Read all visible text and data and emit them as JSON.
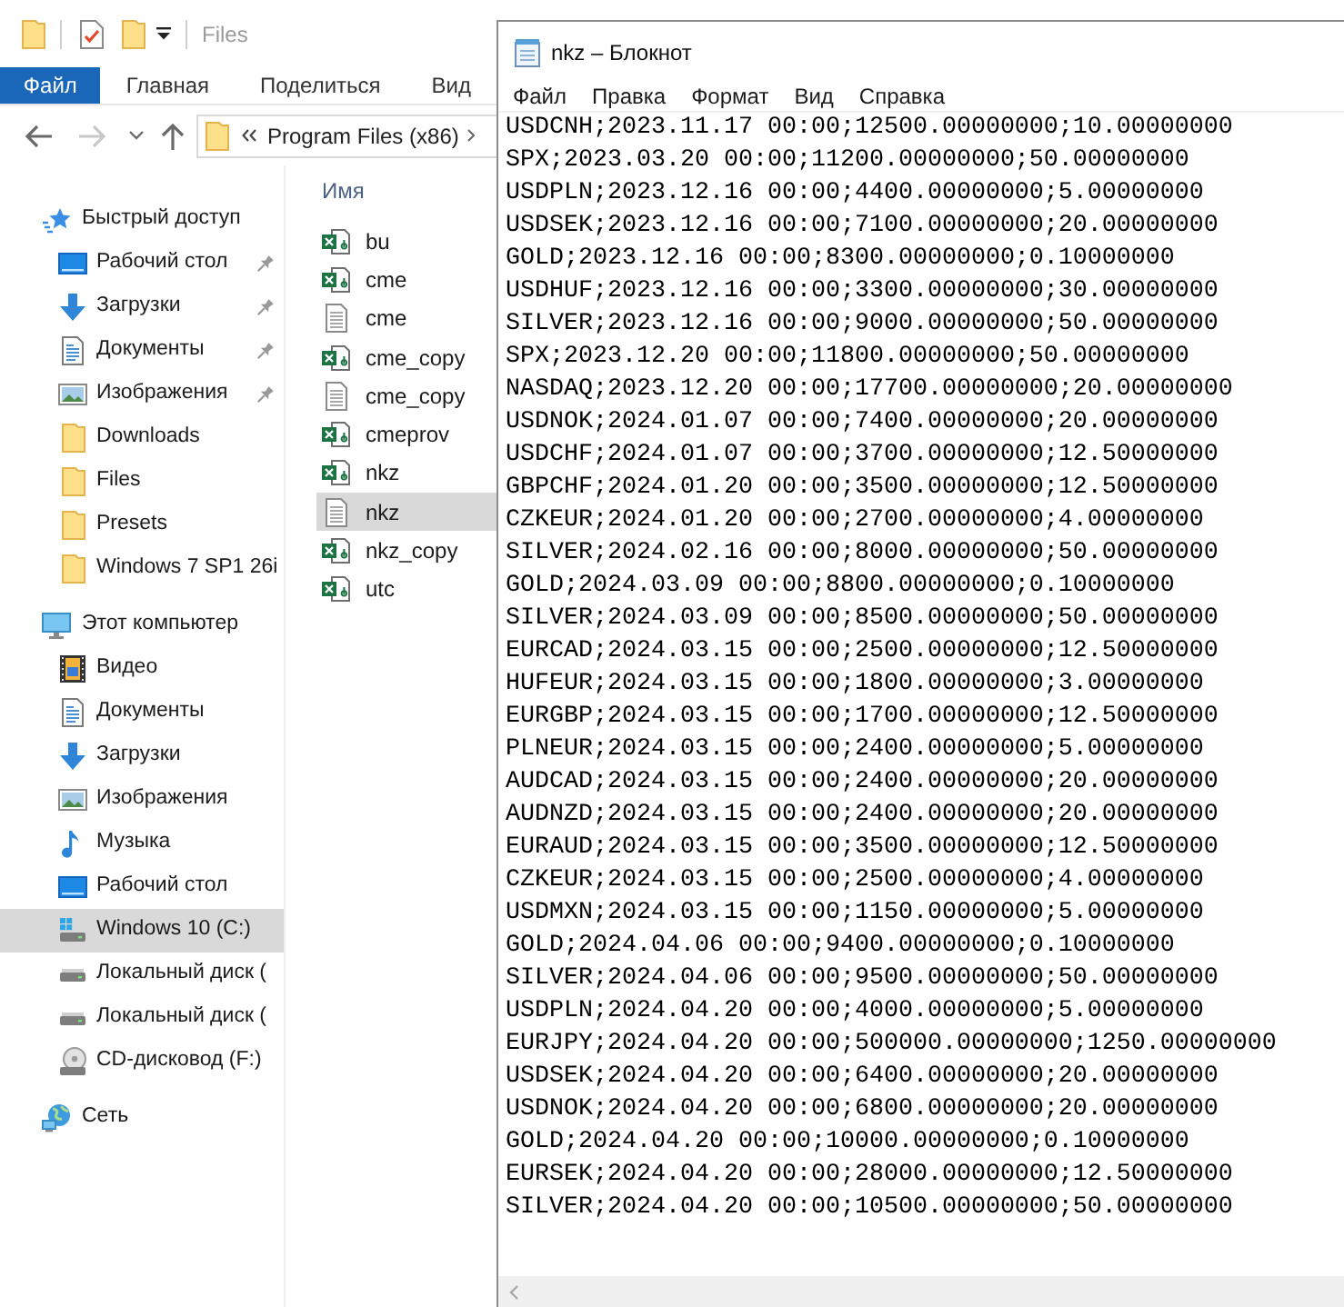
{
  "explorer": {
    "title": "Files",
    "ribbon_tabs": [
      {
        "label": "Файл",
        "kind": "file-menu"
      },
      {
        "label": "Главная",
        "kind": "tab"
      },
      {
        "label": "Поделиться",
        "kind": "tab"
      },
      {
        "label": "Вид",
        "kind": "tab"
      }
    ],
    "nav_buttons": [
      {
        "kind": "back",
        "disabled": false
      },
      {
        "kind": "forward",
        "disabled": true
      },
      {
        "kind": "recent",
        "disabled": false
      },
      {
        "kind": "up",
        "disabled": false
      }
    ],
    "address": {
      "crumbs": [
        "Program Files (x86)"
      ]
    },
    "sidebar": [
      {
        "label": "Быстрый доступ",
        "kind": "quick-access",
        "selected": false,
        "children": [
          {
            "label": "Рабочий стол",
            "kind": "desktop",
            "pinned": true,
            "selected": false
          },
          {
            "label": "Загрузки",
            "kind": "downloads",
            "pinned": true,
            "selected": false
          },
          {
            "label": "Документы",
            "kind": "documents",
            "pinned": true,
            "selected": false
          },
          {
            "label": "Изображения",
            "kind": "pictures",
            "pinned": true,
            "selected": false
          },
          {
            "label": "Downloads",
            "kind": "folder",
            "pinned": false,
            "selected": false
          },
          {
            "label": "Files",
            "kind": "folder",
            "pinned": false,
            "selected": false
          },
          {
            "label": "Presets",
            "kind": "folder",
            "pinned": false,
            "selected": false
          },
          {
            "label": "Windows 7 SP1 26i",
            "kind": "folder",
            "pinned": false,
            "selected": false
          }
        ]
      },
      {
        "label": "Этот компьютер",
        "kind": "computer",
        "selected": false,
        "children": [
          {
            "label": "Видео",
            "kind": "video",
            "selected": false
          },
          {
            "label": "Документы",
            "kind": "documents",
            "selected": false
          },
          {
            "label": "Загрузки",
            "kind": "downloads",
            "selected": false
          },
          {
            "label": "Изображения",
            "kind": "pictures",
            "selected": false
          },
          {
            "label": "Музыка",
            "kind": "music",
            "selected": false
          },
          {
            "label": "Рабочий стол",
            "kind": "desktop",
            "selected": false
          },
          {
            "label": "Windows 10 (C:)",
            "kind": "system-drive",
            "selected": true
          },
          {
            "label": "Локальный диск (",
            "kind": "drive",
            "selected": false
          },
          {
            "label": "Локальный диск (",
            "kind": "drive",
            "selected": false
          },
          {
            "label": "CD-дисковод (F:)",
            "kind": "cd-drive",
            "selected": false
          }
        ]
      },
      {
        "label": "Сеть",
        "kind": "network",
        "selected": false
      }
    ],
    "column_header": "Имя",
    "files": [
      {
        "name": "bu",
        "kind": "spreadsheet",
        "selected": false
      },
      {
        "name": "cme",
        "kind": "spreadsheet",
        "selected": false
      },
      {
        "name": "cme",
        "kind": "text",
        "selected": false
      },
      {
        "name": "cme_copy",
        "kind": "spreadsheet",
        "selected": false
      },
      {
        "name": "cme_copy",
        "kind": "text",
        "selected": false
      },
      {
        "name": "cmeprov",
        "kind": "spreadsheet",
        "selected": false
      },
      {
        "name": "nkz",
        "kind": "spreadsheet",
        "selected": false
      },
      {
        "name": "nkz",
        "kind": "text",
        "selected": true
      },
      {
        "name": "nkz_copy",
        "kind": "spreadsheet",
        "selected": false
      },
      {
        "name": "utc",
        "kind": "spreadsheet",
        "selected": false
      }
    ]
  },
  "notepad": {
    "title": "nkz – Блокнот",
    "menu": [
      "Файл",
      "Правка",
      "Формат",
      "Вид",
      "Справка"
    ],
    "lines": [
      "USDCNH;2023.11.17 00:00;12500.00000000;10.00000000",
      "SPX;2023.03.20 00:00;11200.00000000;50.00000000",
      "USDPLN;2023.12.16 00:00;4400.00000000;5.00000000",
      "USDSEK;2023.12.16 00:00;7100.00000000;20.00000000",
      "GOLD;2023.12.16 00:00;8300.00000000;0.10000000",
      "USDHUF;2023.12.16 00:00;3300.00000000;30.00000000",
      "SILVER;2023.12.16 00:00;9000.00000000;50.00000000",
      "SPX;2023.12.20 00:00;11800.00000000;50.00000000",
      "NASDAQ;2023.12.20 00:00;17700.00000000;20.00000000",
      "USDNOK;2024.01.07 00:00;7400.00000000;20.00000000",
      "USDCHF;2024.01.07 00:00;3700.00000000;12.50000000",
      "GBPCHF;2024.01.20 00:00;3500.00000000;12.50000000",
      "CZKEUR;2024.01.20 00:00;2700.00000000;4.00000000",
      "SILVER;2024.02.16 00:00;8000.00000000;50.00000000",
      "GOLD;2024.03.09 00:00;8800.00000000;0.10000000",
      "SILVER;2024.03.09 00:00;8500.00000000;50.00000000",
      "EURCAD;2024.03.15 00:00;2500.00000000;12.50000000",
      "HUFEUR;2024.03.15 00:00;1800.00000000;3.00000000",
      "EURGBP;2024.03.15 00:00;1700.00000000;12.50000000",
      "PLNEUR;2024.03.15 00:00;2400.00000000;5.00000000",
      "AUDCAD;2024.03.15 00:00;2400.00000000;20.00000000",
      "AUDNZD;2024.03.15 00:00;2400.00000000;20.00000000",
      "EURAUD;2024.03.15 00:00;3500.00000000;12.50000000",
      "CZKEUR;2024.03.15 00:00;2500.00000000;4.00000000",
      "USDMXN;2024.03.15 00:00;1150.00000000;5.00000000",
      "GOLD;2024.04.06 00:00;9400.00000000;0.10000000",
      "SILVER;2024.04.06 00:00;9500.00000000;50.00000000",
      "USDPLN;2024.04.20 00:00;4000.00000000;5.00000000",
      "EURJPY;2024.04.20 00:00;500000.00000000;1250.00000000",
      "USDSEK;2024.04.20 00:00;6400.00000000;20.00000000",
      "USDNOK;2024.04.20 00:00;6800.00000000;20.00000000",
      "GOLD;2024.04.20 00:00;10000.00000000;0.10000000",
      "EURSEK;2024.04.20 00:00;28000.00000000;12.50000000",
      "SILVER;2024.04.20 00:00;10500.00000000;50.00000000"
    ]
  }
}
